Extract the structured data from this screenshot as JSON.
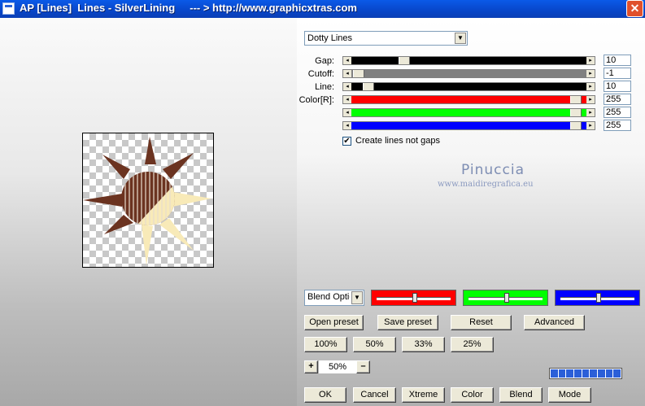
{
  "titlebar": {
    "title": "AP [Lines]  Lines - SilverLining     --- > http://www.graphicxtras.com",
    "close_label": "✕"
  },
  "effect_select": {
    "value": "Dotty Lines"
  },
  "params": [
    {
      "label": "Gap:",
      "value": "10"
    },
    {
      "label": "Cutoff:",
      "value": "-1"
    },
    {
      "label": "Line:",
      "value": "10"
    },
    {
      "label": "Color[R]:",
      "value": "255"
    },
    {
      "label": "",
      "value": "255"
    },
    {
      "label": "",
      "value": "255"
    }
  ],
  "checkbox": {
    "label": "Create lines not gaps",
    "checked": "✔"
  },
  "watermark": {
    "name": "Pinuccia",
    "url": "www.maidiregrafica.eu"
  },
  "blend_select": {
    "value": "Blend Optio"
  },
  "buttons": {
    "open_preset": "Open preset",
    "save_preset": "Save preset",
    "reset": "Reset",
    "advanced": "Advanced",
    "zoom_100": "100%",
    "zoom_50": "50%",
    "zoom_33": "33%",
    "zoom_25": "25%",
    "zoom_in": "+",
    "zoom_out": "–",
    "zoom_value": "50%",
    "ok": "OK",
    "cancel": "Cancel",
    "xtreme": "Xtreme",
    "color": "Color",
    "blend": "Blend",
    "mode": "Mode"
  },
  "colors": {
    "red": "#ff0000",
    "green": "#00ff00",
    "blue": "#0000ff",
    "sun_brown": "#6b3320",
    "sun_cream": "#f8eab8"
  }
}
